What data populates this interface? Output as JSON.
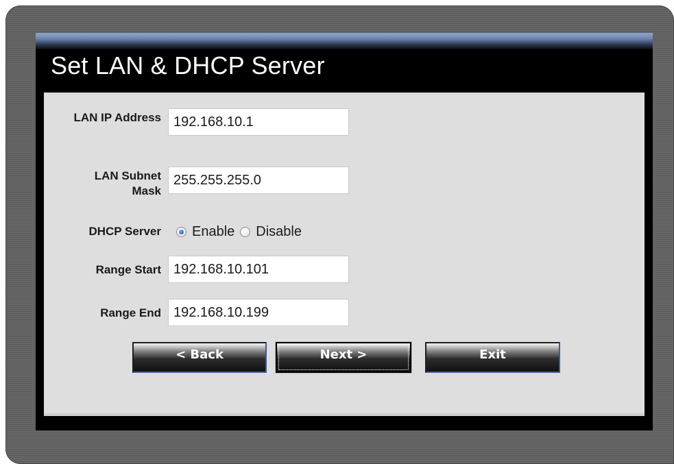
{
  "wizard": {
    "title": "Set LAN & DHCP Server"
  },
  "form": {
    "lan_ip": {
      "label": "LAN IP Address",
      "value": "192.168.10.1"
    },
    "subnet_mask": {
      "label": "LAN Subnet Mask",
      "value": "255.255.255.0"
    },
    "dhcp_server": {
      "label": "DHCP Server",
      "options": [
        "Enable",
        "Disable"
      ],
      "selected": "Enable"
    },
    "range_start": {
      "label": "Range Start",
      "value": "192.168.10.101"
    },
    "range_end": {
      "label": "Range End",
      "value": "192.168.10.199"
    }
  },
  "buttons": {
    "back": "< Back",
    "next": "Next >",
    "exit": "Exit"
  },
  "colors": {
    "title_bar": "#000000",
    "content_bg": "#dedede",
    "accent_strip": "#6d86b1",
    "button_border_accent": "#3d58a8"
  }
}
